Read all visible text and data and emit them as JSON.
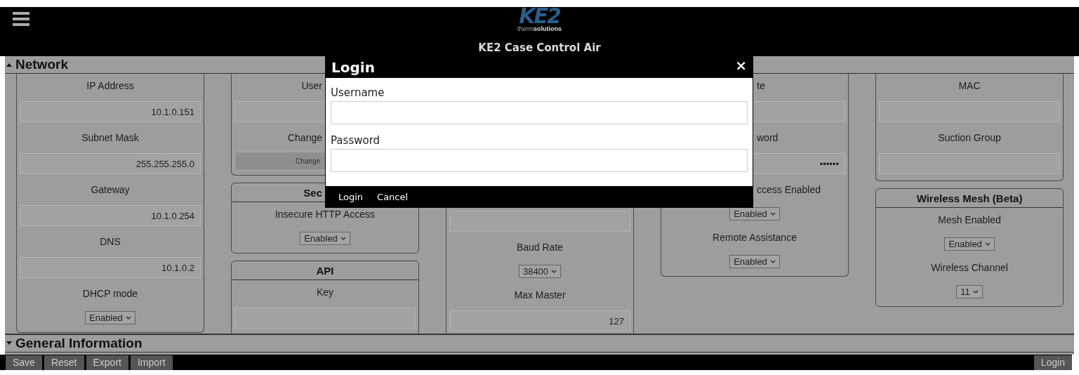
{
  "header": {
    "logo": {
      "mark": "KE2",
      "tagline": "therm**solutions**"
    },
    "title": "KE2 Case Control Air"
  },
  "sections": [
    {
      "title": "Network",
      "expanded": true,
      "columns": [
        [
          {
            "items": [
              {
                "kind": "label",
                "text": "IP Address"
              },
              {
                "kind": "field",
                "value": "10.1.0.151"
              },
              {
                "kind": "label",
                "text": "Subnet Mask"
              },
              {
                "kind": "field",
                "value": "255.255.255.0"
              },
              {
                "kind": "label",
                "text": "Gateway"
              },
              {
                "kind": "field",
                "value": "10.1.0.254"
              },
              {
                "kind": "label",
                "text": "DNS"
              },
              {
                "kind": "field",
                "value": "10.1.0.2"
              },
              {
                "kind": "label",
                "text": "DHCP mode"
              },
              {
                "kind": "select",
                "value": "Enabled"
              }
            ]
          }
        ],
        [
          {
            "items": [
              {
                "kind": "label",
                "text": "User",
                "clipped_right": true
              },
              {
                "kind": "field",
                "value": ""
              },
              {
                "kind": "label",
                "text": "Change",
                "clipped_right": true
              },
              {
                "kind": "button",
                "label": "Change",
                "clipped_right": true
              }
            ]
          },
          {
            "heading": "Sec",
            "heading_clipped_right": true,
            "items": [
              {
                "kind": "label",
                "text": "Insecure HTTP Access"
              },
              {
                "kind": "select",
                "value": "Enabled"
              }
            ]
          },
          {
            "heading": "API",
            "items": [
              {
                "kind": "label",
                "text": "Key"
              },
              {
                "kind": "field",
                "value": ""
              }
            ]
          }
        ],
        [
          {
            "covered": true,
            "items": [
              {
                "kind": "field",
                "value": ""
              },
              {
                "kind": "label",
                "text": "Baud Rate"
              },
              {
                "kind": "select",
                "value": "38400"
              },
              {
                "kind": "label",
                "text": "Max Master"
              },
              {
                "kind": "field",
                "value": "127"
              }
            ]
          }
        ],
        [
          {
            "items": [
              {
                "kind": "label",
                "text": "te",
                "clipped_left": true
              },
              {
                "kind": "field",
                "value": ""
              },
              {
                "kind": "label",
                "text": "word",
                "clipped_left": true
              },
              {
                "kind": "field",
                "value": "••••••"
              },
              {
                "kind": "label",
                "text": "ccess Enabled",
                "clipped_left": true
              },
              {
                "kind": "select",
                "value": "Enabled"
              },
              {
                "kind": "label",
                "text": "Remote Assistance"
              },
              {
                "kind": "select",
                "value": "Enabled"
              }
            ]
          }
        ],
        [
          {
            "items": [
              {
                "kind": "label",
                "text": "MAC"
              },
              {
                "kind": "field",
                "value": ""
              },
              {
                "kind": "label",
                "text": "Suction Group"
              },
              {
                "kind": "field",
                "value": ""
              }
            ]
          },
          {
            "heading": "Wireless Mesh (Beta)",
            "items": [
              {
                "kind": "label",
                "text": "Mesh Enabled"
              },
              {
                "kind": "select",
                "value": "Enabled"
              },
              {
                "kind": "label",
                "text": "Wireless Channel"
              },
              {
                "kind": "select",
                "value": "11"
              }
            ]
          }
        ]
      ]
    },
    {
      "title": "General Information",
      "expanded": false
    }
  ],
  "modal": {
    "title": "Login",
    "close": "×",
    "fields": [
      {
        "label": "Username"
      },
      {
        "label": "Password"
      }
    ],
    "buttons": [
      "Login",
      "Cancel"
    ]
  },
  "toolbar": {
    "buttons": [
      "Save",
      "Reset",
      "Export",
      "Import"
    ],
    "login": "Login"
  }
}
